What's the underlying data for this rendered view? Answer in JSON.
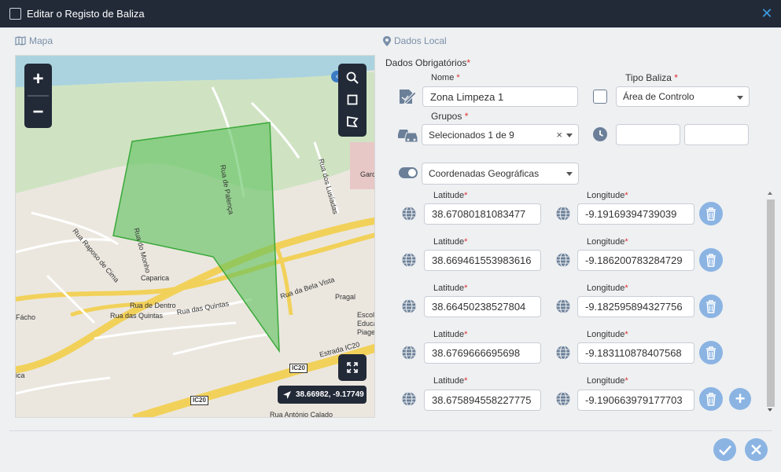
{
  "window": {
    "title": "Editar o Registo de Baliza"
  },
  "map_section": {
    "title": "Mapa"
  },
  "local_section": {
    "title": "Dados Local"
  },
  "map": {
    "zoom_in": "+",
    "zoom_out": "−",
    "coordinates": "38.66982, -9.17749",
    "labels": [
      "Rua de Palença",
      "Rua dos Lusíadas",
      "Rua Raposo de Cima",
      "Rua do Monho",
      "Caparica",
      "Rua de Dentro",
      "Rua das Quintas",
      "Rua das Quintas",
      "Rua da Bela Vista",
      "Pragal",
      "Fácho",
      "Escola",
      "Educa",
      "Piaget",
      "Estrada IC20",
      "Rua António Calado",
      "Garc",
      "ica"
    ],
    "road_signs": [
      "IC20",
      "IC20"
    ]
  },
  "form": {
    "required_title": "Dados Obrigatórios",
    "nome_label": "Nome",
    "nome_value": "Zona Limpeza 1",
    "tipo_label": "Tipo Baliza",
    "tipo_value": "Área de Controlo",
    "grupos_label": "Grupos",
    "grupos_value": "Selecionados 1 de 9",
    "grupos_clear": "×",
    "coord_type": "Coordenadas Geográficas",
    "lat_label": "Latitude",
    "lon_label": "Longitude",
    "star": "*",
    "points": [
      {
        "lat": "38.67080181083477",
        "lon": "-9.19169394739039"
      },
      {
        "lat": "38.669461553983616",
        "lon": "-9.186200783284729"
      },
      {
        "lat": "38.66450238527804",
        "lon": "-9.182595894327756"
      },
      {
        "lat": "38.6769666695698",
        "lon": "-9.183110878407568"
      },
      {
        "lat": "38.675894558227775",
        "lon": "-9.190663979177703"
      }
    ]
  },
  "colors": {
    "accent": "#8bb4e3",
    "titlebar": "#222a38",
    "polygon": "#5cc15c"
  }
}
